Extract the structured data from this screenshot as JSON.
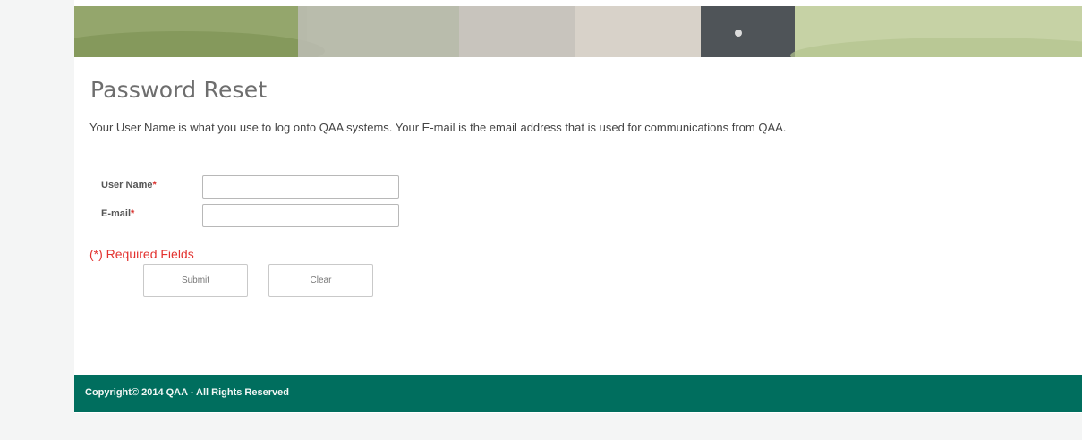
{
  "page": {
    "title": "Password Reset",
    "intro": "Your User Name is what you use to log onto QAA systems. Your E-mail is the email address that is used for communications from QAA."
  },
  "form": {
    "user_name_label": "User Name",
    "email_label": "E-mail",
    "required_marker": "*",
    "user_name_value": "",
    "email_value": "",
    "required_note": "(*) Required Fields",
    "submit_label": "Submit",
    "clear_label": "Clear"
  },
  "footer": {
    "copyright": "Copyright© 2014 QAA - All Rights Reserved"
  },
  "colors": {
    "footer_bg": "#006e5e",
    "required_red": "#e3322f"
  }
}
